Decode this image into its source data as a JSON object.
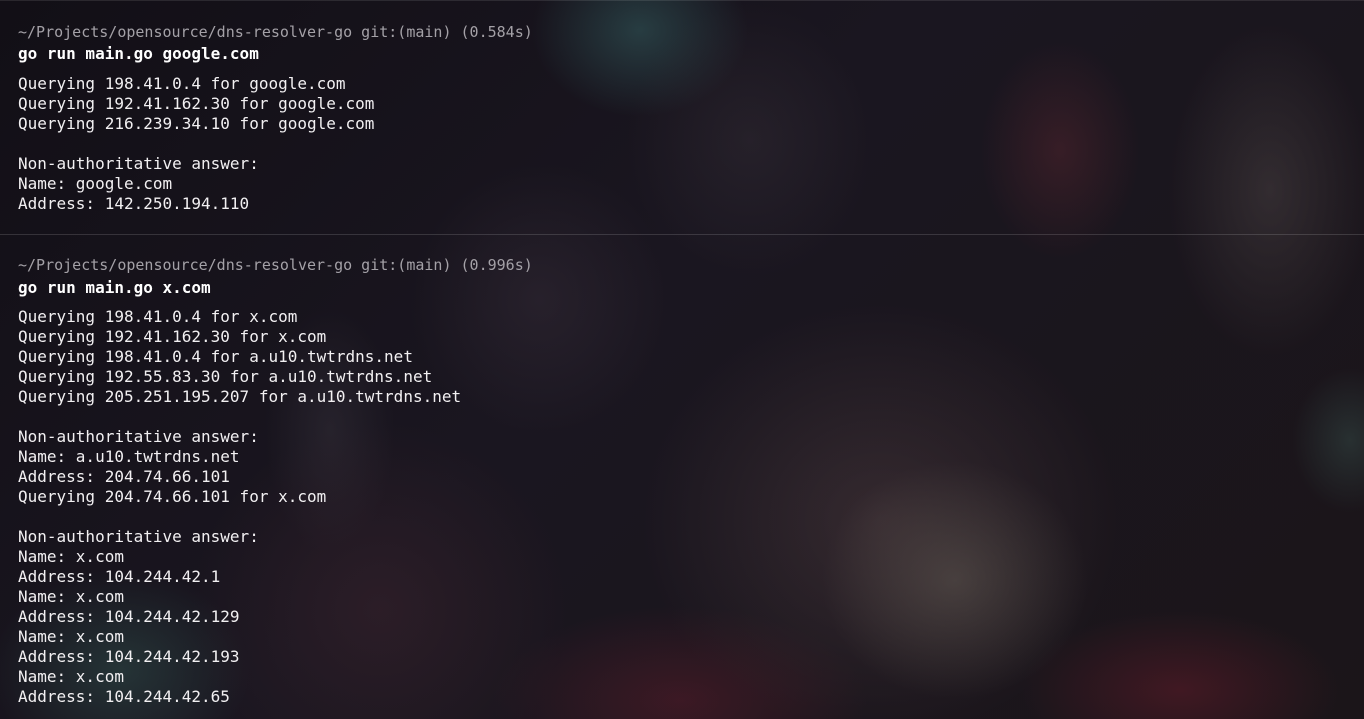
{
  "terminal": {
    "blocks": [
      {
        "prompt": "~/Projects/opensource/dns-resolver-go git:(main) (0.584s)",
        "command": "go run main.go google.com",
        "lines": [
          "Querying 198.41.0.4 for google.com",
          "Querying 192.41.162.30 for google.com",
          "Querying 216.239.34.10 for google.com",
          "",
          "Non-authoritative answer:",
          "Name: google.com",
          "Address: 142.250.194.110"
        ]
      },
      {
        "prompt": "~/Projects/opensource/dns-resolver-go git:(main) (0.996s)",
        "command": "go run main.go x.com",
        "lines": [
          "Querying 198.41.0.4 for x.com",
          "Querying 192.41.162.30 for x.com",
          "Querying 198.41.0.4 for a.u10.twtrdns.net",
          "Querying 192.55.83.30 for a.u10.twtrdns.net",
          "Querying 205.251.195.207 for a.u10.twtrdns.net",
          "",
          "Non-authoritative answer:",
          "Name: a.u10.twtrdns.net",
          "Address: 204.74.66.101",
          "Querying 204.74.66.101 for x.com",
          "",
          "Non-authoritative answer:",
          "Name: x.com",
          "Address: 104.244.42.1",
          "Name: x.com",
          "Address: 104.244.42.129",
          "Name: x.com",
          "Address: 104.244.42.193",
          "Name: x.com",
          "Address: 104.244.42.65"
        ]
      }
    ]
  }
}
